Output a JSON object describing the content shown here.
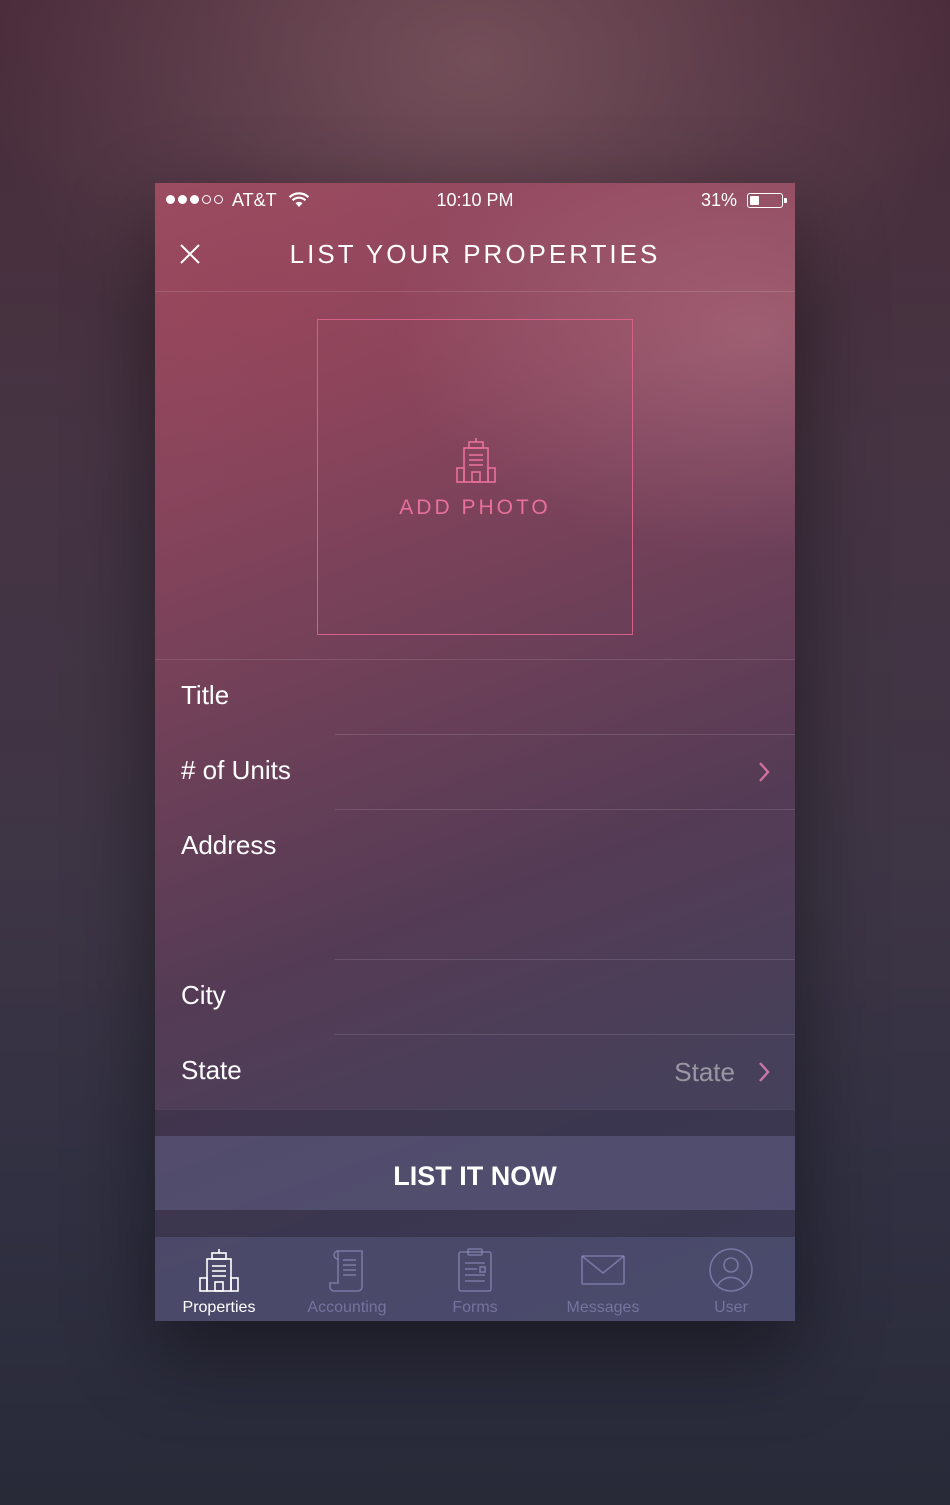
{
  "status_bar": {
    "carrier": "AT&T",
    "time": "10:10 PM",
    "battery_percent": "31%",
    "battery_level": 0.31,
    "signal_bars_filled": 3,
    "signal_bars_total": 5
  },
  "header": {
    "title": "LIST YOUR PROPERTIES",
    "close_icon": "close-icon"
  },
  "photo": {
    "label": "ADD PHOTO",
    "icon": "building-icon",
    "accent_color": "#e8709a"
  },
  "form": {
    "fields": [
      {
        "label": "Title",
        "value": "",
        "has_chevron": false
      },
      {
        "label": "# of Units",
        "value": "",
        "has_chevron": true
      },
      {
        "label": "Address",
        "value": "",
        "has_chevron": false
      },
      {
        "label": "City",
        "value": "",
        "has_chevron": false
      },
      {
        "label": "State",
        "value": "State",
        "has_chevron": true
      }
    ]
  },
  "submit": {
    "label": "LIST IT NOW"
  },
  "tabs": [
    {
      "label": "Properties",
      "icon": "building-icon",
      "active": true
    },
    {
      "label": "Accounting",
      "icon": "scroll-icon",
      "active": false
    },
    {
      "label": "Forms",
      "icon": "clipboard-icon",
      "active": false
    },
    {
      "label": "Messages",
      "icon": "envelope-icon",
      "active": false
    },
    {
      "label": "User",
      "icon": "user-icon",
      "active": false
    }
  ]
}
